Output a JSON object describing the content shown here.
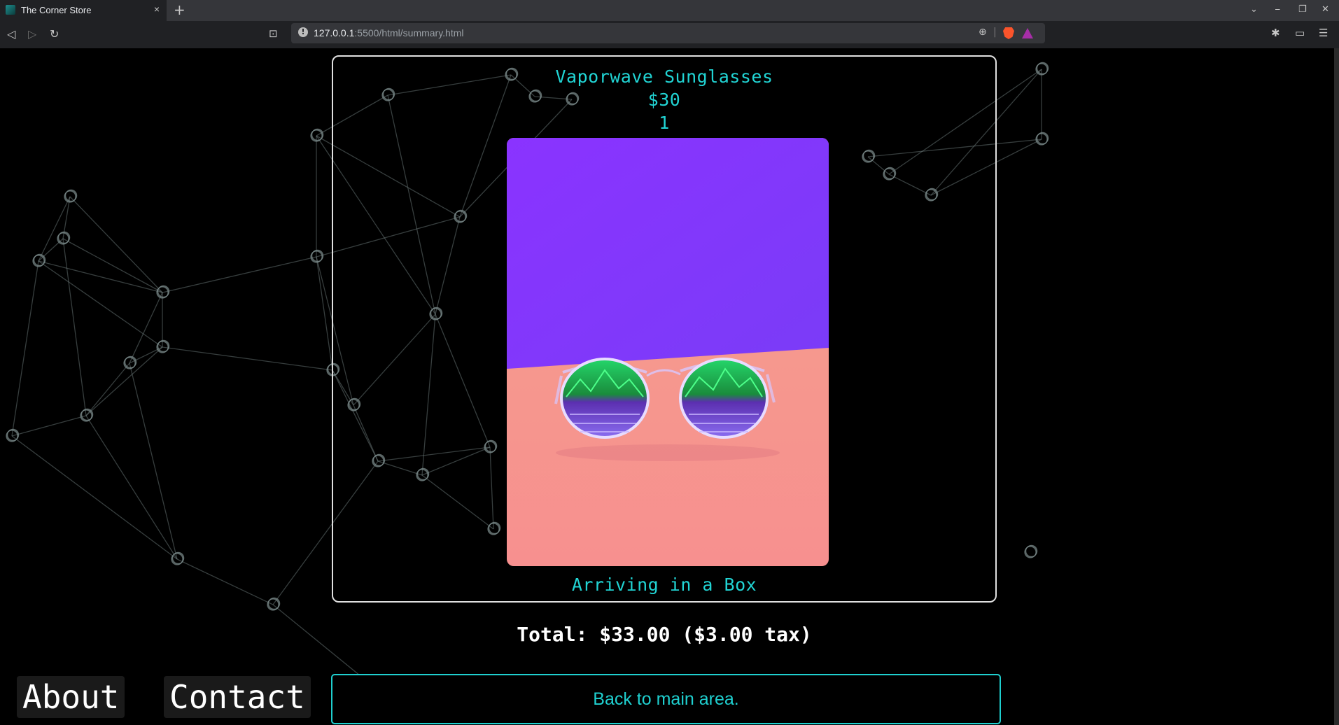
{
  "browser": {
    "tab_title": "The Corner Store",
    "tab_close": "×",
    "new_tab": "+",
    "url_host": "127.0.0.1",
    "url_path": ":5500/html/summary.html",
    "win_min": "⎯",
    "win_restore": "❐",
    "win_close": "✕",
    "win_menu": "⌄"
  },
  "product": {
    "name": "Vaporwave Sunglasses",
    "price": "$30",
    "quantity": "1",
    "shipping": "Arriving in a Box"
  },
  "summary": {
    "total_text": "Total: $33.00 ($3.00 tax)"
  },
  "nav": {
    "back_label": "Back to main area.",
    "about_label": "About",
    "contact_label": "Contact"
  },
  "colors": {
    "accent": "#21d4d4",
    "background": "#000000",
    "image_top": "#8a33ff",
    "image_bottom": "#f7908f"
  }
}
